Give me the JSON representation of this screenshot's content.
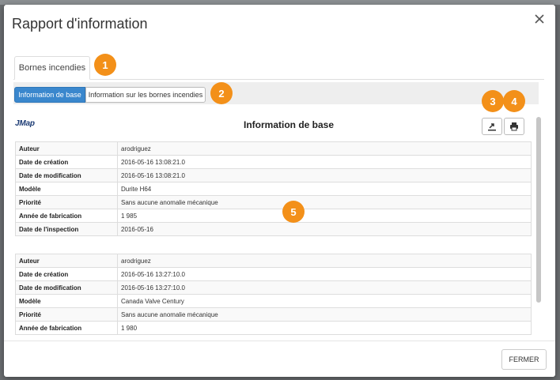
{
  "dialog": {
    "title": "Rapport d'information",
    "close_icon": "close-icon",
    "close_button": "FERMER"
  },
  "tabs": [
    {
      "label": "Bornes incendies",
      "selected": true
    }
  ],
  "subtabs": [
    {
      "label": "Information de base",
      "selected": true
    },
    {
      "label": "Information sur les bornes incendies",
      "selected": false
    }
  ],
  "badges": [
    "1",
    "2",
    "3",
    "4",
    "5"
  ],
  "content": {
    "logo": "JMap",
    "title": "Information de base",
    "export_icon": "export-icon",
    "print_icon": "print-icon"
  },
  "records": [
    {
      "rows": [
        {
          "label": "Auteur",
          "value": "arodriguez"
        },
        {
          "label": "Date de création",
          "value": "2016-05-16 13:08:21.0"
        },
        {
          "label": "Date de modification",
          "value": "2016-05-16 13:08:21.0"
        },
        {
          "label": "Modèle",
          "value": "Durite H64"
        },
        {
          "label": "Priorité",
          "value": "Sans aucune anomalie mécanique"
        },
        {
          "label": "Année de fabrication",
          "value": "1 985"
        },
        {
          "label": "Date de l'inspection",
          "value": "2016-05-16"
        }
      ]
    },
    {
      "rows": [
        {
          "label": "Auteur",
          "value": "arodriguez"
        },
        {
          "label": "Date de création",
          "value": "2016-05-16 13:27:10.0"
        },
        {
          "label": "Date de modification",
          "value": "2016-05-16 13:27:10.0"
        },
        {
          "label": "Modèle",
          "value": "Canada Valve Century"
        },
        {
          "label": "Priorité",
          "value": "Sans aucune anomalie mécanique"
        },
        {
          "label": "Année de fabrication",
          "value": "1 980"
        }
      ]
    }
  ],
  "colors": {
    "accent": "#3a87cd",
    "badge": "#f39019"
  }
}
